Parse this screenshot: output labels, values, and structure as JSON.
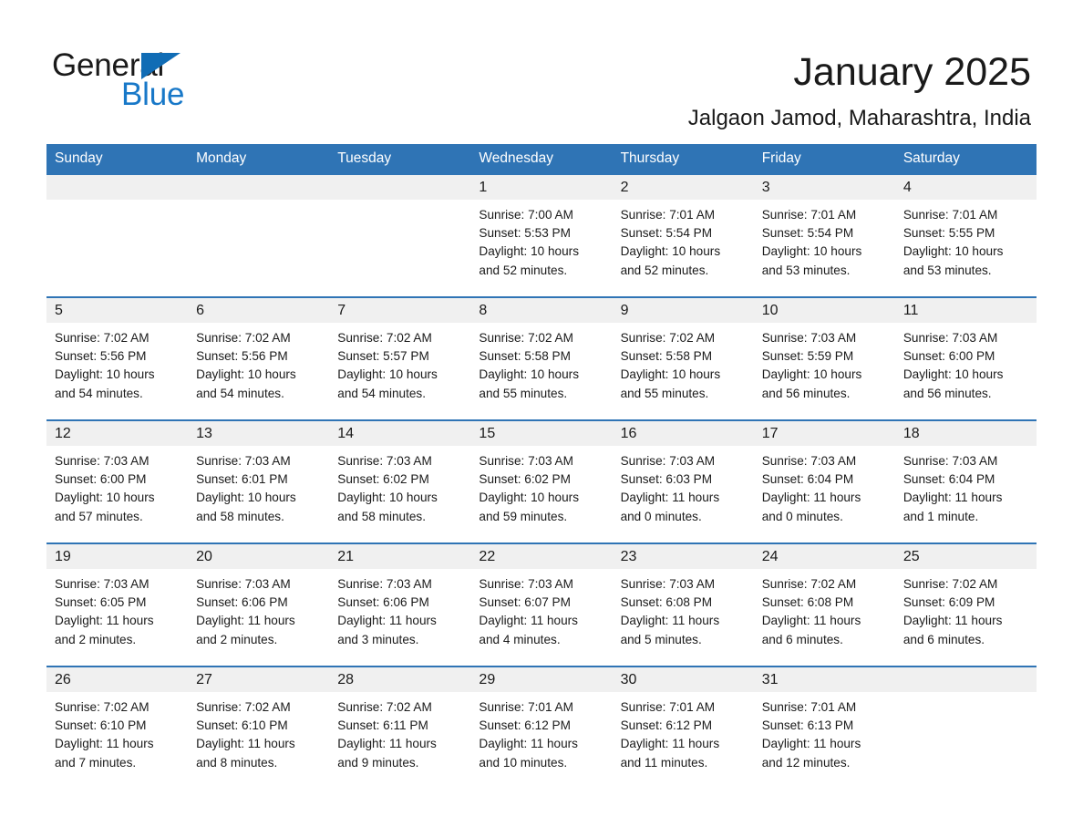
{
  "brand": {
    "line1": "General",
    "line2": "Blue",
    "accent_color": "#1878c8",
    "triangle_color": "#106cb5"
  },
  "header": {
    "title": "January 2025",
    "location": "Jalgaon Jamod, Maharashtra, India"
  },
  "calendar": {
    "header_color": "#2f74b5",
    "daynum_band_color": "#f0f0f0",
    "weekday_headers": [
      "Sunday",
      "Monday",
      "Tuesday",
      "Wednesday",
      "Thursday",
      "Friday",
      "Saturday"
    ],
    "weeks": [
      [
        {
          "day": "",
          "empty": true
        },
        {
          "day": "",
          "empty": true
        },
        {
          "day": "",
          "empty": true
        },
        {
          "day": "1",
          "sunrise": "Sunrise: 7:00 AM",
          "sunset": "Sunset: 5:53 PM",
          "daylight_line1": "Daylight: 10 hours",
          "daylight_line2": "and 52 minutes."
        },
        {
          "day": "2",
          "sunrise": "Sunrise: 7:01 AM",
          "sunset": "Sunset: 5:54 PM",
          "daylight_line1": "Daylight: 10 hours",
          "daylight_line2": "and 52 minutes."
        },
        {
          "day": "3",
          "sunrise": "Sunrise: 7:01 AM",
          "sunset": "Sunset: 5:54 PM",
          "daylight_line1": "Daylight: 10 hours",
          "daylight_line2": "and 53 minutes."
        },
        {
          "day": "4",
          "sunrise": "Sunrise: 7:01 AM",
          "sunset": "Sunset: 5:55 PM",
          "daylight_line1": "Daylight: 10 hours",
          "daylight_line2": "and 53 minutes."
        }
      ],
      [
        {
          "day": "5",
          "sunrise": "Sunrise: 7:02 AM",
          "sunset": "Sunset: 5:56 PM",
          "daylight_line1": "Daylight: 10 hours",
          "daylight_line2": "and 54 minutes."
        },
        {
          "day": "6",
          "sunrise": "Sunrise: 7:02 AM",
          "sunset": "Sunset: 5:56 PM",
          "daylight_line1": "Daylight: 10 hours",
          "daylight_line2": "and 54 minutes."
        },
        {
          "day": "7",
          "sunrise": "Sunrise: 7:02 AM",
          "sunset": "Sunset: 5:57 PM",
          "daylight_line1": "Daylight: 10 hours",
          "daylight_line2": "and 54 minutes."
        },
        {
          "day": "8",
          "sunrise": "Sunrise: 7:02 AM",
          "sunset": "Sunset: 5:58 PM",
          "daylight_line1": "Daylight: 10 hours",
          "daylight_line2": "and 55 minutes."
        },
        {
          "day": "9",
          "sunrise": "Sunrise: 7:02 AM",
          "sunset": "Sunset: 5:58 PM",
          "daylight_line1": "Daylight: 10 hours",
          "daylight_line2": "and 55 minutes."
        },
        {
          "day": "10",
          "sunrise": "Sunrise: 7:03 AM",
          "sunset": "Sunset: 5:59 PM",
          "daylight_line1": "Daylight: 10 hours",
          "daylight_line2": "and 56 minutes."
        },
        {
          "day": "11",
          "sunrise": "Sunrise: 7:03 AM",
          "sunset": "Sunset: 6:00 PM",
          "daylight_line1": "Daylight: 10 hours",
          "daylight_line2": "and 56 minutes."
        }
      ],
      [
        {
          "day": "12",
          "sunrise": "Sunrise: 7:03 AM",
          "sunset": "Sunset: 6:00 PM",
          "daylight_line1": "Daylight: 10 hours",
          "daylight_line2": "and 57 minutes."
        },
        {
          "day": "13",
          "sunrise": "Sunrise: 7:03 AM",
          "sunset": "Sunset: 6:01 PM",
          "daylight_line1": "Daylight: 10 hours",
          "daylight_line2": "and 58 minutes."
        },
        {
          "day": "14",
          "sunrise": "Sunrise: 7:03 AM",
          "sunset": "Sunset: 6:02 PM",
          "daylight_line1": "Daylight: 10 hours",
          "daylight_line2": "and 58 minutes."
        },
        {
          "day": "15",
          "sunrise": "Sunrise: 7:03 AM",
          "sunset": "Sunset: 6:02 PM",
          "daylight_line1": "Daylight: 10 hours",
          "daylight_line2": "and 59 minutes."
        },
        {
          "day": "16",
          "sunrise": "Sunrise: 7:03 AM",
          "sunset": "Sunset: 6:03 PM",
          "daylight_line1": "Daylight: 11 hours",
          "daylight_line2": "and 0 minutes."
        },
        {
          "day": "17",
          "sunrise": "Sunrise: 7:03 AM",
          "sunset": "Sunset: 6:04 PM",
          "daylight_line1": "Daylight: 11 hours",
          "daylight_line2": "and 0 minutes."
        },
        {
          "day": "18",
          "sunrise": "Sunrise: 7:03 AM",
          "sunset": "Sunset: 6:04 PM",
          "daylight_line1": "Daylight: 11 hours",
          "daylight_line2": "and 1 minute."
        }
      ],
      [
        {
          "day": "19",
          "sunrise": "Sunrise: 7:03 AM",
          "sunset": "Sunset: 6:05 PM",
          "daylight_line1": "Daylight: 11 hours",
          "daylight_line2": "and 2 minutes."
        },
        {
          "day": "20",
          "sunrise": "Sunrise: 7:03 AM",
          "sunset": "Sunset: 6:06 PM",
          "daylight_line1": "Daylight: 11 hours",
          "daylight_line2": "and 2 minutes."
        },
        {
          "day": "21",
          "sunrise": "Sunrise: 7:03 AM",
          "sunset": "Sunset: 6:06 PM",
          "daylight_line1": "Daylight: 11 hours",
          "daylight_line2": "and 3 minutes."
        },
        {
          "day": "22",
          "sunrise": "Sunrise: 7:03 AM",
          "sunset": "Sunset: 6:07 PM",
          "daylight_line1": "Daylight: 11 hours",
          "daylight_line2": "and 4 minutes."
        },
        {
          "day": "23",
          "sunrise": "Sunrise: 7:03 AM",
          "sunset": "Sunset: 6:08 PM",
          "daylight_line1": "Daylight: 11 hours",
          "daylight_line2": "and 5 minutes."
        },
        {
          "day": "24",
          "sunrise": "Sunrise: 7:02 AM",
          "sunset": "Sunset: 6:08 PM",
          "daylight_line1": "Daylight: 11 hours",
          "daylight_line2": "and 6 minutes."
        },
        {
          "day": "25",
          "sunrise": "Sunrise: 7:02 AM",
          "sunset": "Sunset: 6:09 PM",
          "daylight_line1": "Daylight: 11 hours",
          "daylight_line2": "and 6 minutes."
        }
      ],
      [
        {
          "day": "26",
          "sunrise": "Sunrise: 7:02 AM",
          "sunset": "Sunset: 6:10 PM",
          "daylight_line1": "Daylight: 11 hours",
          "daylight_line2": "and 7 minutes."
        },
        {
          "day": "27",
          "sunrise": "Sunrise: 7:02 AM",
          "sunset": "Sunset: 6:10 PM",
          "daylight_line1": "Daylight: 11 hours",
          "daylight_line2": "and 8 minutes."
        },
        {
          "day": "28",
          "sunrise": "Sunrise: 7:02 AM",
          "sunset": "Sunset: 6:11 PM",
          "daylight_line1": "Daylight: 11 hours",
          "daylight_line2": "and 9 minutes."
        },
        {
          "day": "29",
          "sunrise": "Sunrise: 7:01 AM",
          "sunset": "Sunset: 6:12 PM",
          "daylight_line1": "Daylight: 11 hours",
          "daylight_line2": "and 10 minutes."
        },
        {
          "day": "30",
          "sunrise": "Sunrise: 7:01 AM",
          "sunset": "Sunset: 6:12 PM",
          "daylight_line1": "Daylight: 11 hours",
          "daylight_line2": "and 11 minutes."
        },
        {
          "day": "31",
          "sunrise": "Sunrise: 7:01 AM",
          "sunset": "Sunset: 6:13 PM",
          "daylight_line1": "Daylight: 11 hours",
          "daylight_line2": "and 12 minutes."
        },
        {
          "day": "",
          "empty": true
        }
      ]
    ]
  }
}
